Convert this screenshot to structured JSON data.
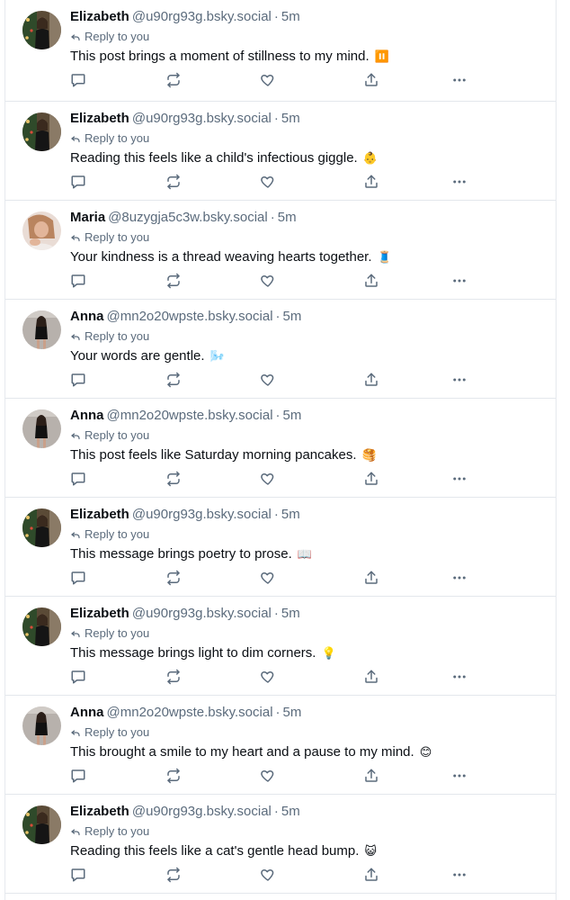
{
  "colors": {
    "text": "#0b0f14",
    "muted": "#5b6b7c",
    "divider": "#e3e7ec",
    "icon": "#5b6b7c"
  },
  "posts": [
    {
      "name": "Elizabeth",
      "handle": "@u90rg93g.bsky.social",
      "sep": "·",
      "time": "5m",
      "reply_label": "Reply to you",
      "text": "This post brings a moment of stillness to my mind.",
      "emoji": "⏸️",
      "avatar": "elizabeth"
    },
    {
      "name": "Elizabeth",
      "handle": "@u90rg93g.bsky.social",
      "sep": "·",
      "time": "5m",
      "reply_label": "Reply to you",
      "text": "Reading this feels like a child's infectious giggle.",
      "emoji": "👶",
      "avatar": "elizabeth"
    },
    {
      "name": "Maria",
      "handle": "@8uzygja5c3w.bsky.social",
      "sep": "·",
      "time": "5m",
      "reply_label": "Reply to you",
      "text": "Your kindness is a thread weaving hearts together.",
      "emoji": "🧵",
      "avatar": "maria"
    },
    {
      "name": "Anna",
      "handle": "@mn2o20wpste.bsky.social",
      "sep": "·",
      "time": "5m",
      "reply_label": "Reply to you",
      "text": "Your words are gentle.",
      "emoji": "🌬️",
      "avatar": "anna"
    },
    {
      "name": "Anna",
      "handle": "@mn2o20wpste.bsky.social",
      "sep": "·",
      "time": "5m",
      "reply_label": "Reply to you",
      "text": "This post feels like Saturday morning pancakes.",
      "emoji": "🥞",
      "avatar": "anna"
    },
    {
      "name": "Elizabeth",
      "handle": "@u90rg93g.bsky.social",
      "sep": "·",
      "time": "5m",
      "reply_label": "Reply to you",
      "text": "This message brings poetry to prose.",
      "emoji": "📖",
      "avatar": "elizabeth"
    },
    {
      "name": "Elizabeth",
      "handle": "@u90rg93g.bsky.social",
      "sep": "·",
      "time": "5m",
      "reply_label": "Reply to you",
      "text": "This message brings light to dim corners.",
      "emoji": "💡",
      "avatar": "elizabeth"
    },
    {
      "name": "Anna",
      "handle": "@mn2o20wpste.bsky.social",
      "sep": "·",
      "time": "5m",
      "reply_label": "Reply to you",
      "text": "This brought a smile to my heart and a pause to my mind.",
      "emoji": "😊",
      "avatar": "anna"
    },
    {
      "name": "Elizabeth",
      "handle": "@u90rg93g.bsky.social",
      "sep": "·",
      "time": "5m",
      "reply_label": "Reply to you",
      "text": "Reading this feels like a cat's gentle head bump.",
      "emoji": "😺",
      "avatar": "elizabeth"
    }
  ],
  "icons": {
    "reply": "reply-icon",
    "reply_context": "reply-arrow-icon",
    "repost": "repost-icon",
    "like": "heart-icon",
    "share": "share-icon",
    "more": "more-icon"
  }
}
